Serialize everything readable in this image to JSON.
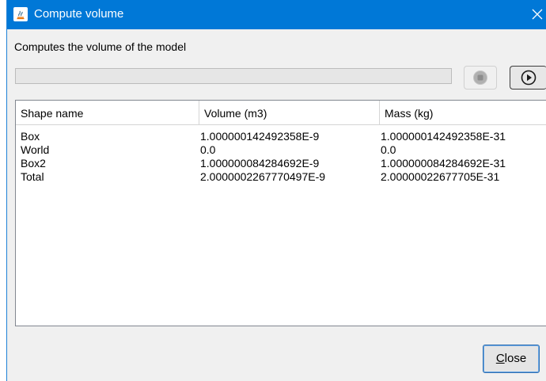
{
  "window": {
    "title": "Compute volume",
    "description": "Computes the volume of the model"
  },
  "progress": {
    "fraction": 0.0
  },
  "controls": {
    "stop_icon": "stop-icon",
    "run_icon": "play-icon"
  },
  "table": {
    "columns": [
      "Shape name",
      "Volume (m3)",
      "Mass (kg)"
    ],
    "rows": [
      [
        "Box",
        "1.000000142492358E-9",
        "1.000000142492358E-31"
      ],
      [
        "World",
        "0.0",
        "0.0"
      ],
      [
        "Box2",
        "1.000000084284692E-9",
        "1.000000084284692E-31"
      ],
      [
        "Total",
        "2.0000002267770497E-9",
        "2.00000022677705E-31"
      ]
    ]
  },
  "footer": {
    "close_mnemonic": "C",
    "close_rest": "lose"
  },
  "colors": {
    "titlebar": "#0078d7",
    "window_bg": "#f0f0f0"
  }
}
